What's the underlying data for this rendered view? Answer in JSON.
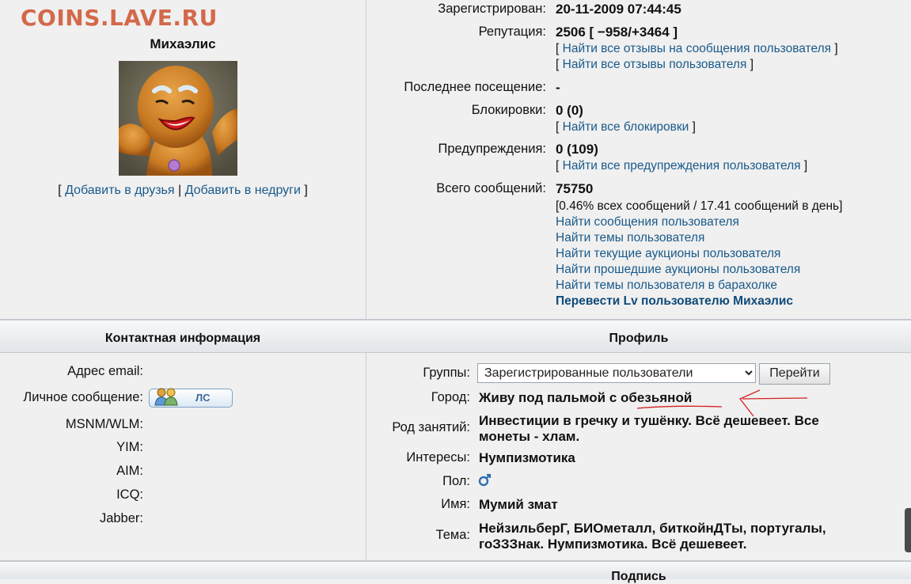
{
  "watermark": "COINS.LAVE.RU",
  "user": {
    "name": "Михаэлис",
    "friends_prefix": "[",
    "add_friend": "Добавить в друзья",
    "sep": "|",
    "add_enemy": "Добавить в недруги",
    "friends_suffix": "]"
  },
  "stats": {
    "registered_label": "Зарегистрирован:",
    "registered_value": "20-11-2009 07:44:45",
    "reputation_label": "Репутация:",
    "reputation_value": "2506 [ −958/+3464 ]",
    "reputation_link1": "Найти все отзывы на сообщения пользователя",
    "reputation_link2": "Найти все отзывы пользователя",
    "last_visit_label": "Последнее посещение:",
    "last_visit_value": "-",
    "blocks_label": "Блокировки:",
    "blocks_value": "0 (0)",
    "blocks_link": "Найти все блокировки",
    "warnings_label": "Предупреждения:",
    "warnings_value": "0 (109)",
    "warnings_link": "Найти все предупреждения пользователя",
    "posts_label": "Всего сообщений:",
    "posts_value": "75750",
    "posts_detail": "[0.46% всех сообщений / 17.41 сообщений в день]",
    "find_posts": "Найти сообщения пользователя",
    "find_topics": "Найти темы пользователя",
    "find_current_auctions": "Найти текущие аукционы пользователя",
    "find_past_auctions": "Найти прошедшие аукционы пользователя",
    "find_flea_topics": "Найти темы пользователя в барахолке",
    "transfer_lv": "Перевести Lv пользователю Михаэлис"
  },
  "bracket_open": "[",
  "bracket_close": "]",
  "sections": {
    "contact": "Контактная информация",
    "profile": "Профиль",
    "signature": "Подпись"
  },
  "contact": {
    "email_label": "Адрес email:",
    "pm_label": "Личное сообщение:",
    "pm_button": "ЛС",
    "msnm_label": "MSNM/WLM:",
    "yim_label": "YIM:",
    "aim_label": "AIM:",
    "icq_label": "ICQ:",
    "jabber_label": "Jabber:"
  },
  "profile": {
    "groups_label": "Группы:",
    "groups_selected": "Зарегистрированные пользователи",
    "go_button": "Перейти",
    "city_label": "Город:",
    "city_value": "Живу под пальмой с обезьяной",
    "occupation_label": "Род занятий:",
    "occupation_line1": "Инвестиции в гречку и тушёнку. Всё дешевеет. Все",
    "occupation_line2": "монеты - хлам.",
    "interests_label": "Интересы:",
    "interests_value": "Нумпизмотика",
    "gender_label": "Пол:",
    "name_label": "Имя:",
    "name_value": "Мумий змат",
    "theme_label": "Тема:",
    "theme_line1": "НейзильберГ, БИОметалл, биткойнДТы, португалы,",
    "theme_line2": "гоЗЗЗнак. Нумпизмотика. Всё дешевеет."
  },
  "colors": {
    "link": "#1a5a8a",
    "watermark": "#d3694a",
    "annotation": "#d42020"
  },
  "icons": {
    "pm": "users-icon",
    "gender": "male-icon",
    "avatar": "gingerbread-man-avatar"
  }
}
